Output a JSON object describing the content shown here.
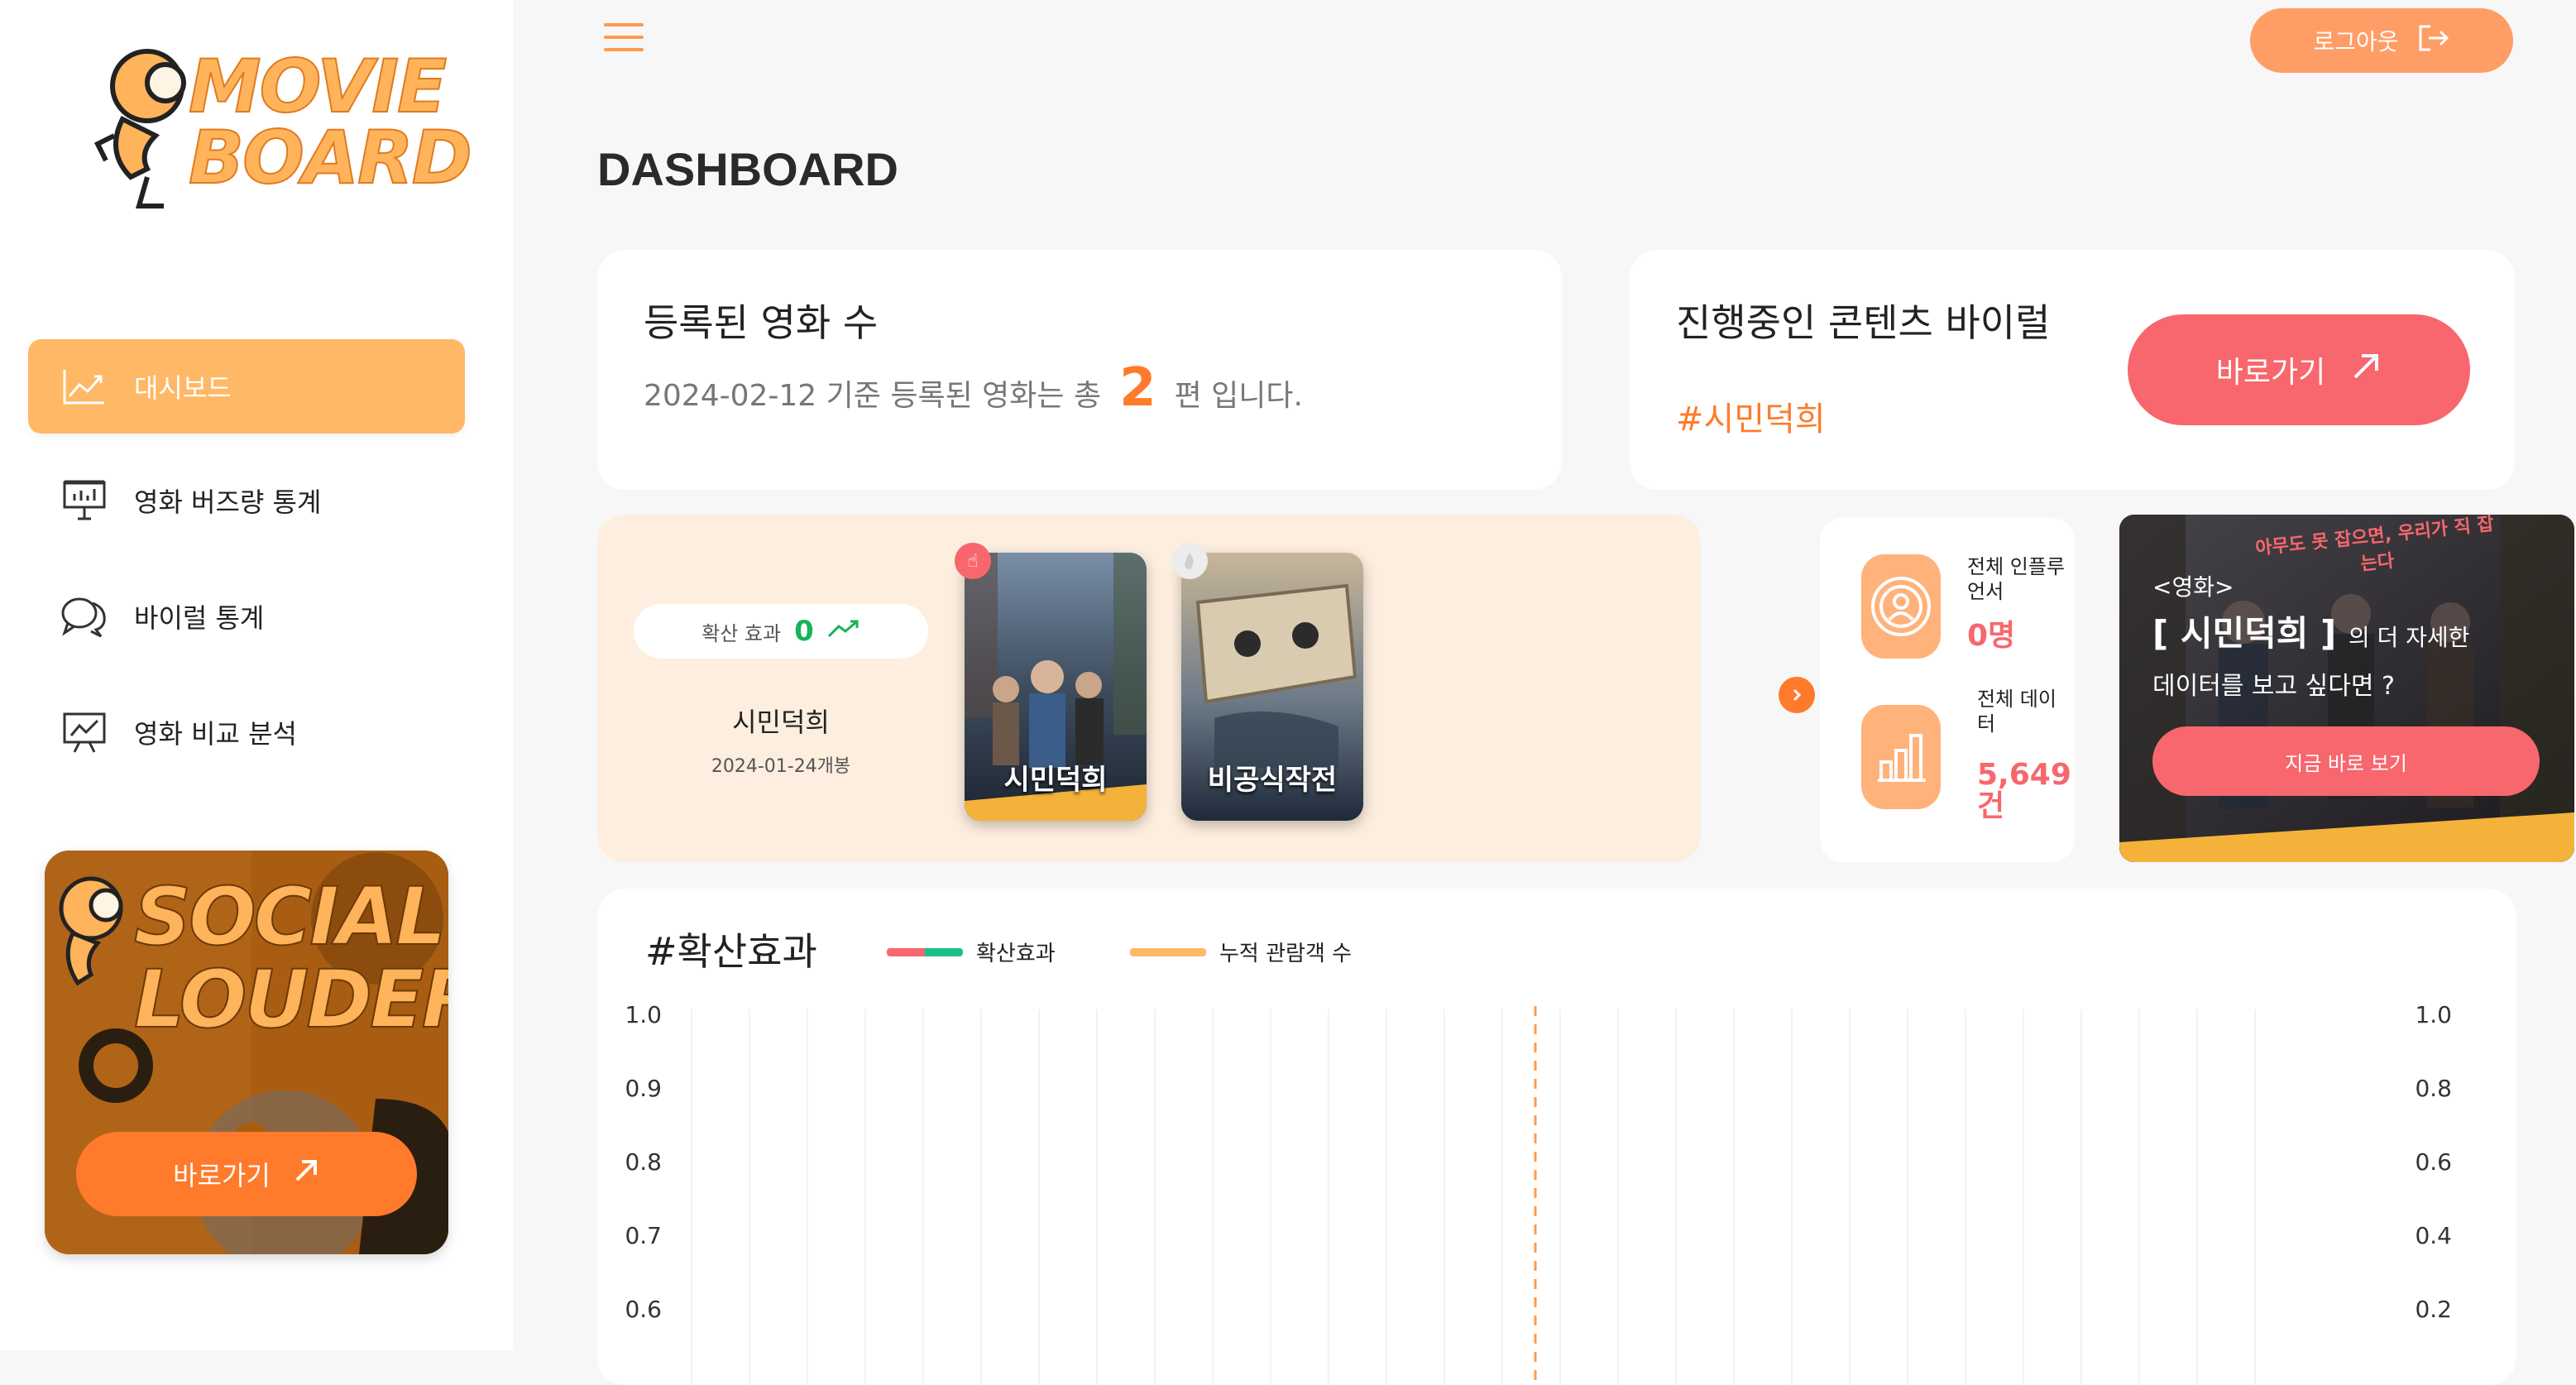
{
  "app": {
    "logo_text": "MOVIE BOARD",
    "page_title": "DASHBOARD",
    "logout_label": "로그아웃"
  },
  "sidebar": {
    "items": [
      {
        "label": "대시보드",
        "icon": "trend-chart-icon",
        "active": true
      },
      {
        "label": "영화 버즈량 통계",
        "icon": "presentation-board-icon",
        "active": false
      },
      {
        "label": "바이럴 통계",
        "icon": "chat-bubbles-icon",
        "active": false
      },
      {
        "label": "영화 비교 분석",
        "icon": "analytics-board-icon",
        "active": false
      }
    ],
    "promo": {
      "logo_text": "SOCIAL LOUDER",
      "button_label": "바로가기"
    }
  },
  "movie_count_card": {
    "title": "등록된 영화 수",
    "prefix": "2024-02-12 기준 등록된 영화는 총",
    "count": "2",
    "suffix": "편 입니다."
  },
  "viral_card": {
    "title": "진행중인 콘텐츠 바이럴",
    "tag": "#시민덕희",
    "button_label": "바로가기"
  },
  "movie_strip": {
    "effect_label": "확산 효과",
    "effect_value": "0",
    "movie_title": "시민덕희",
    "movie_date": "2024-01-24개봉",
    "posters": [
      {
        "title": "시민덕희",
        "selected": true
      },
      {
        "title": "비공식작전",
        "selected": false
      }
    ]
  },
  "stats": {
    "influencers_label": "전체 인플루언서",
    "influencers_value": "0명",
    "data_label": "전체 데이터",
    "data_value": "5,649건"
  },
  "banner": {
    "line1": "<영화>",
    "movie": "[ 시민덕희 ]",
    "line2_suffix": "의 더 자세한",
    "line3": "데이터를 보고 싶다면 ?",
    "button_label": "지금 바로 보기",
    "poster_tagline": "아무도 못 잡으면, 우리가 직 잡는다"
  },
  "colors": {
    "accent_orange": "#ff7a2a",
    "accent_light_orange": "#ffb866",
    "accent_red": "#f7676d",
    "accent_green": "#19b35a"
  },
  "chart_data": {
    "type": "line",
    "title": "#확산효과",
    "series": [
      {
        "name": "확산효과",
        "values": [],
        "colors": [
          "#f7676d",
          "#19c08a"
        ]
      },
      {
        "name": "누적 관람객 수",
        "values": [],
        "colors": [
          "#ffb866"
        ]
      }
    ],
    "y_left_ticks": [
      "1.0",
      "0.9",
      "0.8",
      "0.7",
      "0.6"
    ],
    "y_right_ticks": [
      "1.0",
      "0.8",
      "0.6",
      "0.4",
      "0.2"
    ],
    "ylim_left": [
      0,
      1.0
    ],
    "ylim_right": [
      0,
      1.0
    ],
    "grid": "vertical",
    "legend": "top"
  }
}
